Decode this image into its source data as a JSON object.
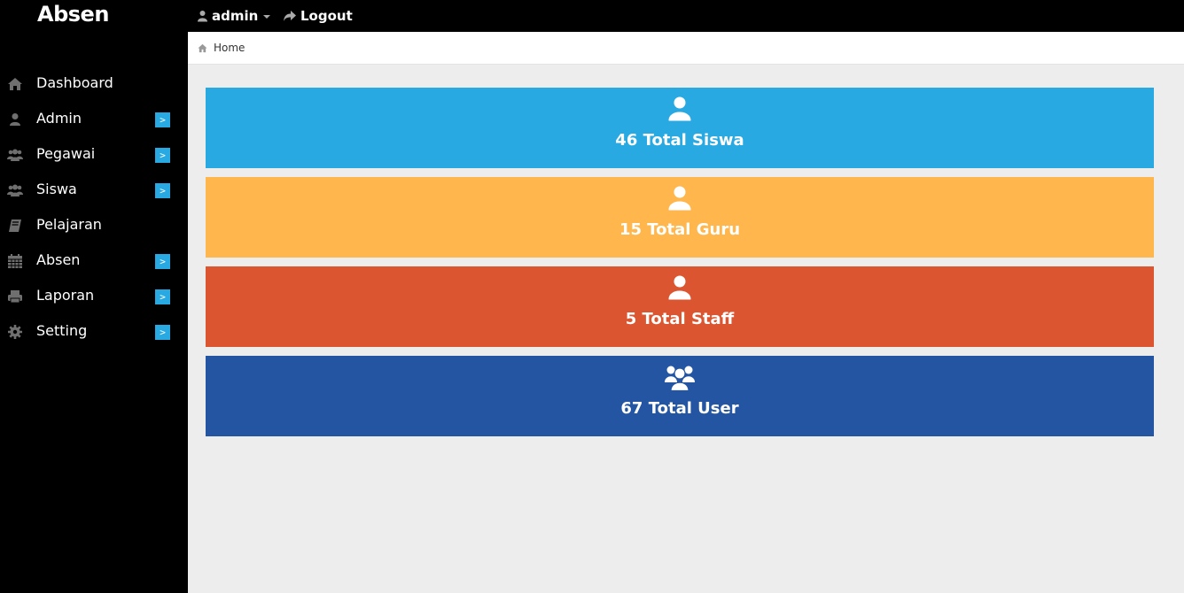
{
  "sidebar": {
    "brand": "Absen",
    "items": [
      {
        "label": "Dashboard",
        "icon": "home-icon",
        "arrow": ""
      },
      {
        "label": "Admin",
        "icon": "user-icon",
        "arrow": ">"
      },
      {
        "label": "Pegawai",
        "icon": "users-icon",
        "arrow": ">"
      },
      {
        "label": "Siswa",
        "icon": "users-icon",
        "arrow": ">"
      },
      {
        "label": "Pelajaran",
        "icon": "book-icon",
        "arrow": ""
      },
      {
        "label": "Absen",
        "icon": "calendar-icon",
        "arrow": ">"
      },
      {
        "label": "Laporan",
        "icon": "print-icon",
        "arrow": ">"
      },
      {
        "label": "Setting",
        "icon": "gear-icon",
        "arrow": ">"
      }
    ]
  },
  "topbar": {
    "user": "admin",
    "logout": "Logout"
  },
  "breadcrumb": {
    "home": "Home"
  },
  "stats": [
    {
      "text": "46 Total Siswa",
      "icon": "user-icon",
      "color": "#29a9e2"
    },
    {
      "text": "15 Total Guru",
      "icon": "user-icon",
      "color": "#ffb74d"
    },
    {
      "text": "5 Total Staff",
      "icon": "user-icon",
      "color": "#db5630"
    },
    {
      "text": "67 Total User",
      "icon": "users-icon",
      "color": "#2355a3"
    }
  ],
  "colors": {
    "accent": "#29a9e2",
    "sidebar_bg": "#000000",
    "content_bg": "#ededed"
  }
}
